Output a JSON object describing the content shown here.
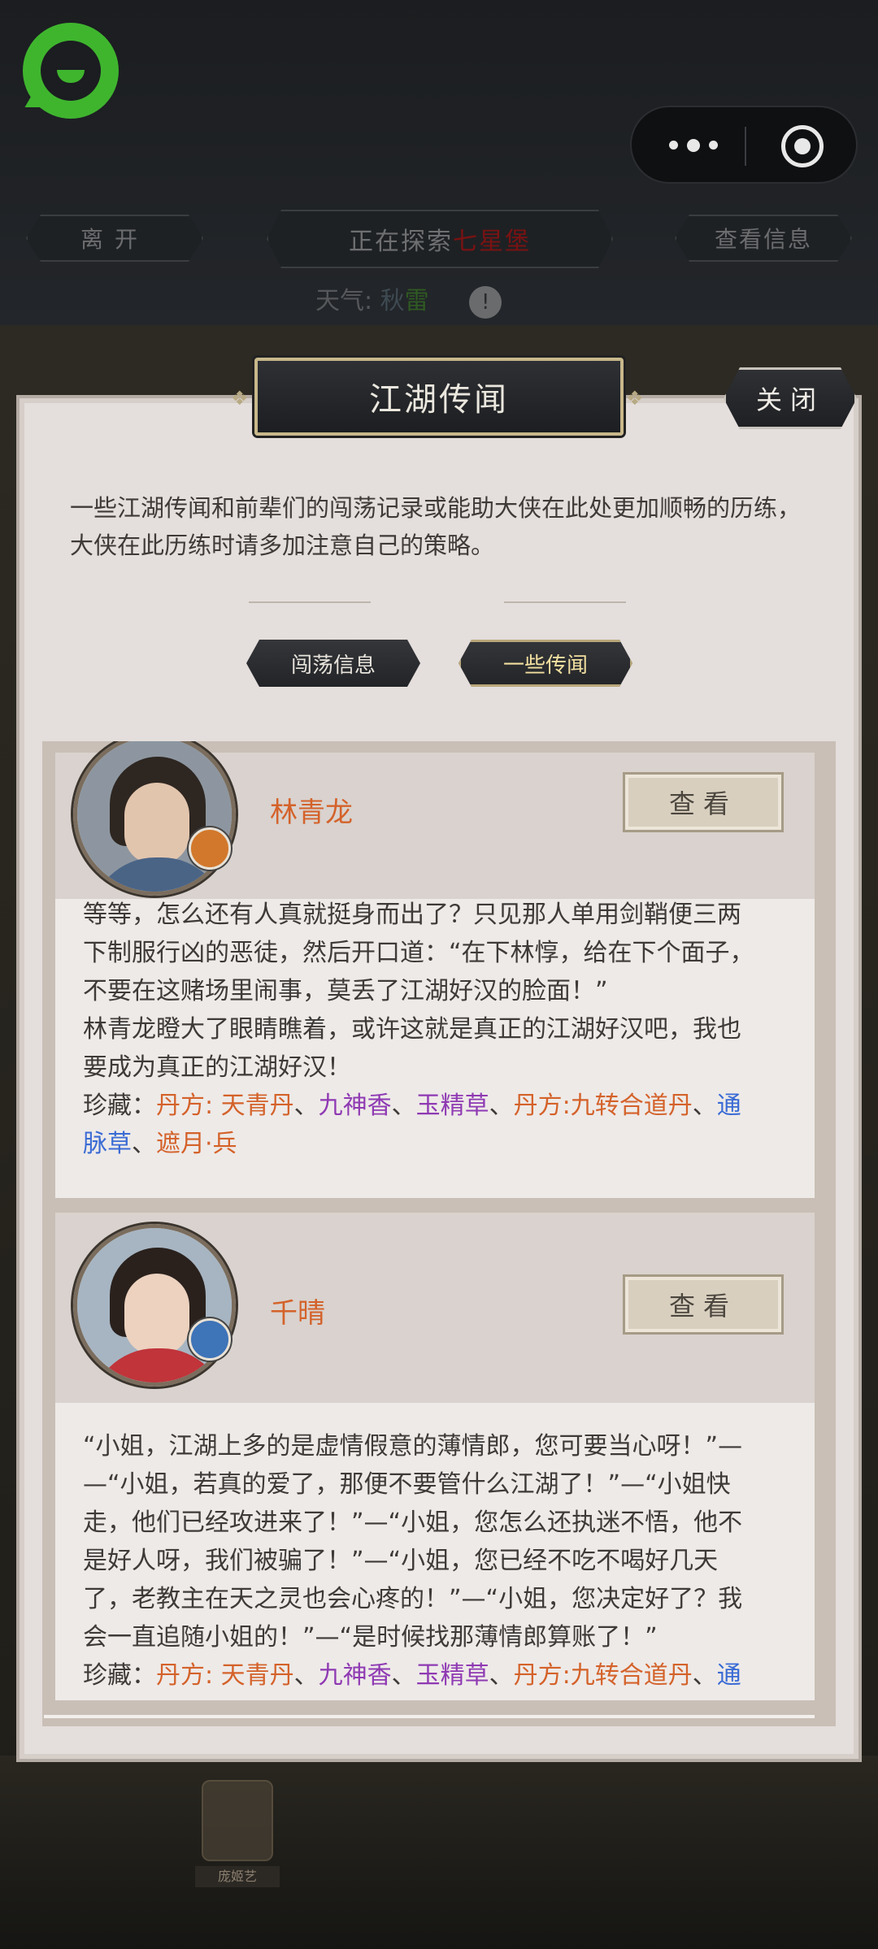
{
  "topbar": {
    "leave_label": "离开",
    "explore_prefix": "正在探索",
    "explore_place": "七星堡",
    "info_label": "查看信息",
    "weather_label": "天气:",
    "weather_value_1": "秋",
    "weather_value_2": "雷",
    "alert_glyph": "!"
  },
  "modal": {
    "title": "江湖传闻",
    "close_label": "关闭",
    "intro": "一些江湖传闻和前辈们的闯荡记录或能助大侠在此处更加顺畅的历练，大侠在此历练时请多加注意自己的策略。",
    "tabs": [
      {
        "label": "闯荡信息",
        "active": false
      },
      {
        "label": "一些传闻",
        "active": true
      }
    ]
  },
  "cards": [
    {
      "name": "林青龙",
      "view_label": "查看",
      "story_lines": [
        "等等，怎么还有人真就挺身而出了？只见那人单用剑鞘便三两",
        "下制服行凶的恶徒，然后开口道：“在下林惇，给在下个面子，",
        "不要在这赌场里闹事，莫丢了江湖好汉的脸面！”",
        "林青龙瞪大了眼睛瞧着，或许这就是真正的江湖好汉吧，我也",
        "要成为真正的江湖好汉！"
      ],
      "treasure_label": "珍藏：",
      "treasures_line1": [
        {
          "text": "丹方: 天青丹",
          "color": "orange"
        },
        {
          "text": "、",
          "color": "plain"
        },
        {
          "text": "九神香",
          "color": "purple"
        },
        {
          "text": "、",
          "color": "plain"
        },
        {
          "text": "玉精草",
          "color": "purple"
        },
        {
          "text": "、",
          "color": "plain"
        },
        {
          "text": "丹方:九转合道丹",
          "color": "orange"
        },
        {
          "text": "、",
          "color": "plain"
        },
        {
          "text": "通",
          "color": "blue"
        }
      ],
      "treasures_line2": [
        {
          "text": "脉草",
          "color": "blue"
        },
        {
          "text": "、",
          "color": "plain"
        },
        {
          "text": "遮月·兵",
          "color": "orange"
        }
      ]
    },
    {
      "name": "千晴",
      "view_label": "查看",
      "story_lines": [
        "“小姐，江湖上多的是虚情假意的薄情郎，您可要当心呀！”—",
        "—“小姐，若真的爱了，那便不要管什么江湖了！”—“小姐快",
        "走，他们已经攻进来了！”—“小姐，您怎么还执迷不悟，他不",
        "是好人呀，我们被骗了！”—“小姐，您已经不吃不喝好几天",
        "了，老教主在天之灵也会心疼的！”—“小姐，您决定好了？我",
        "会一直追随小姐的！”—“是时候找那薄情郎算账了！”"
      ],
      "treasure_label": "珍藏：",
      "treasures_line1": [
        {
          "text": "丹方: 天青丹",
          "color": "orange"
        },
        {
          "text": "、",
          "color": "plain"
        },
        {
          "text": "九神香",
          "color": "purple"
        },
        {
          "text": "、",
          "color": "plain"
        },
        {
          "text": "玉精草",
          "color": "purple"
        },
        {
          "text": "、",
          "color": "plain"
        },
        {
          "text": "丹方:九转合道丹",
          "color": "orange"
        },
        {
          "text": "、",
          "color": "plain"
        },
        {
          "text": "通",
          "color": "blue"
        }
      ]
    }
  ],
  "scene": {
    "npc_name": "庞姬艺"
  },
  "colors": {
    "accent_orange": "#d4622a",
    "accent_purple": "#8f3ab3",
    "accent_blue": "#3a6bd4",
    "logo_green": "#3fb52e"
  },
  "icons": {
    "logo": "chat-bubble-logo-icon",
    "more": "more-dots-icon",
    "close_app": "target-circle-icon",
    "alert": "exclamation-circle-icon"
  }
}
